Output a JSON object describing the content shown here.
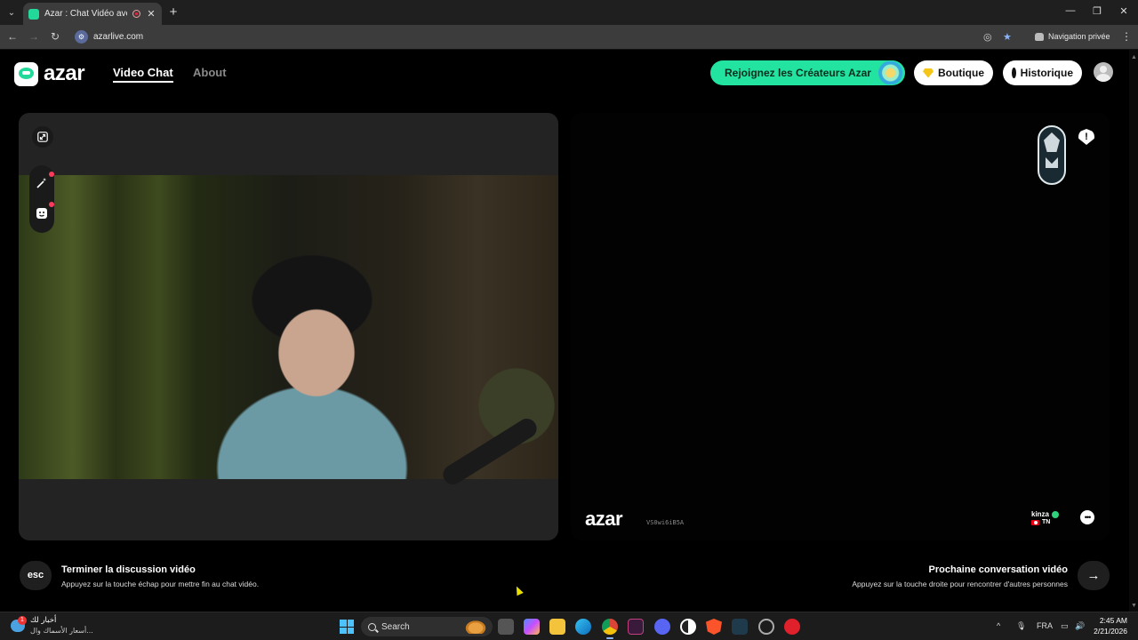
{
  "browser": {
    "tab_title": "Azar : Chat Vidéo avec de n",
    "tab_close": "✕",
    "new_tab": "+",
    "url": "azarlive.com",
    "private_label": "Navigation privée",
    "win_min": "—",
    "win_max": "❐",
    "win_close": "✕",
    "icons": [
      "back-icon",
      "forward-icon",
      "reload-icon",
      "eye-off-icon",
      "star-icon",
      "incognito-icon",
      "menu-icon"
    ]
  },
  "header": {
    "logo_text": "azar",
    "nav": {
      "video_chat": "Video Chat",
      "about": "About"
    },
    "creators_label": "Rejoignez les Créateurs Azar",
    "shop_label": "Boutique",
    "history_label": "Historique",
    "accent_color": "#22e3a0"
  },
  "partner": {
    "watermark_logo": "azar",
    "watermark_code": "VS0wi6iB5A",
    "name": "kinza",
    "country": "TN",
    "report_symbol": "!",
    "chat_symbol": "•••"
  },
  "hints": {
    "esc_key": "esc",
    "end_title": "Terminer la discussion vidéo",
    "end_sub": "Appuyez sur la touche échap pour mettre fin au chat vidéo.",
    "next_title": "Prochaine conversation vidéo",
    "next_sub": "Appuyez sur la touche droite pour rencontrer d'autres personnes",
    "next_arrow": "→"
  },
  "taskbar": {
    "news_line1": "أخبار لك",
    "news_line2": "أسعار الأسماك وال...",
    "news_badge": "1",
    "search_label": "Search",
    "language": "FRA",
    "time": "2:45 AM",
    "date": "2/21/2026"
  }
}
